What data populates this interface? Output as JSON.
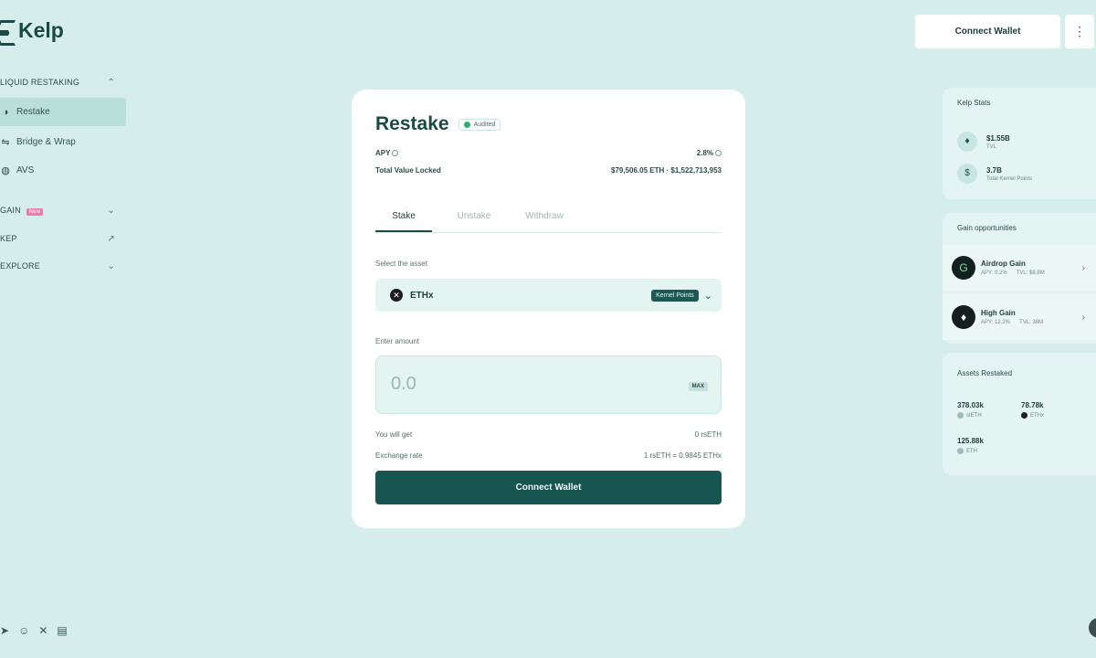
{
  "brand": {
    "name": "Kelp"
  },
  "sidebar": {
    "sections": [
      {
        "label": "LIQUID RESTAKING"
      },
      {
        "label": "GAIN",
        "badge": "New"
      },
      {
        "label": "KEP"
      },
      {
        "label": "EXPLORE"
      }
    ],
    "items": [
      {
        "label": "Restake"
      },
      {
        "label": "Bridge & Wrap"
      },
      {
        "label": "AVS"
      }
    ]
  },
  "header": {
    "connect_label": "Connect Wallet",
    "menu_icon": "⋮"
  },
  "card": {
    "title": "Restake",
    "audited_label": "Audited",
    "apy_label": "APY",
    "apy_value": "2.8%",
    "tvl_label": "Total Value Locked",
    "tvl_value": "$79,506.05 ETH · $1,522,713,953",
    "tabs": [
      "Stake",
      "Unstake",
      "Withdraw"
    ],
    "asset_label": "Select the asset",
    "asset_name": "ETHx",
    "points_label": "Kernel Points",
    "amount_label": "Enter amount",
    "amount_placeholder": "0.0",
    "max_label": "MAX",
    "get_label": "You will get",
    "get_value": "0 rsETH",
    "rate_label": "Exchange rate",
    "rate_value": "1 rsETH = 0.9845 ETHx",
    "connect_label": "Connect Wallet"
  },
  "kelp_stats": {
    "title": "Kelp Stats",
    "items": [
      {
        "value": "$1.55B",
        "label": "TVL"
      },
      {
        "value": "3.7B",
        "label": "Total Kernel Points"
      }
    ]
  },
  "gain": {
    "title": "Gain opportunities",
    "items": [
      {
        "name": "Airdrop Gain",
        "apy": "APY: 0.2%",
        "tvl": "TVL: $8.8M"
      },
      {
        "name": "High Gain",
        "apy": "APY: 12.2%",
        "tvl": "TVL: 38M"
      }
    ]
  },
  "assets": {
    "title": "Assets Restaked",
    "items": [
      {
        "value": "378.03k",
        "label": "stETH"
      },
      {
        "value": "78.78k",
        "label": "ETHx"
      },
      {
        "value": "125.88k",
        "label": "ETH"
      }
    ]
  }
}
